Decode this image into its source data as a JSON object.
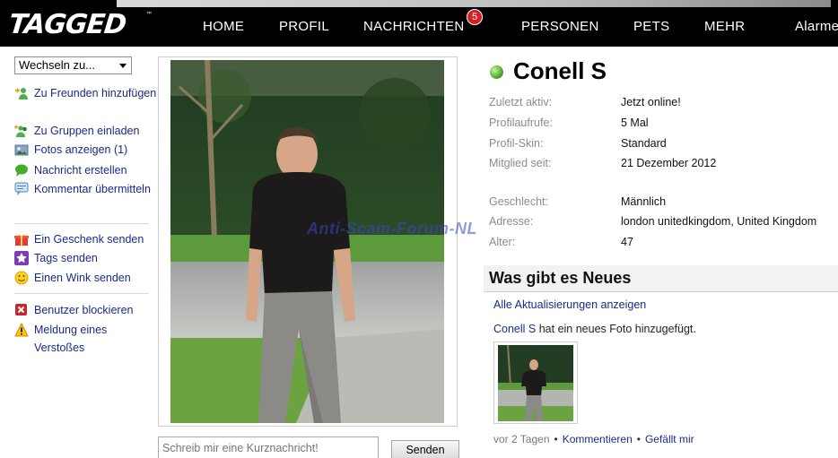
{
  "header": {
    "logo": "TAGGED",
    "logo_tm": "™",
    "nav": [
      "HOME",
      "PROFIL",
      "NACHRICHTEN",
      "PERSONEN",
      "PETS",
      "MEHR",
      "Alarme"
    ],
    "messages_badge": "5"
  },
  "sidebar": {
    "switch_select": "Wechseln zu...",
    "actions": [
      {
        "label": "Zu Freunden hinzufügen",
        "icon": "add-friend-icon"
      },
      {
        "label": "Zu Gruppen einladen",
        "icon": "invite-group-icon"
      },
      {
        "label": "Fotos anzeigen (1)",
        "icon": "photos-icon"
      },
      {
        "label": "Nachricht erstellen",
        "icon": "chat-bubble-icon"
      },
      {
        "label": "Kommentar übermitteln",
        "icon": "comment-icon"
      },
      {
        "label": "Ein Geschenk senden",
        "icon": "gift-icon"
      },
      {
        "label": "Tags senden",
        "icon": "star-icon"
      },
      {
        "label": "Einen Wink senden",
        "icon": "smiley-icon"
      },
      {
        "label": "Benutzer blockieren",
        "icon": "block-icon"
      },
      {
        "label": "Meldung eines Verstoßes",
        "icon": "warning-icon"
      }
    ]
  },
  "shoutbox": {
    "placeholder": "Schreib mir eine Kurznachricht!",
    "send_label": "Senden"
  },
  "profile": {
    "name": "Conell S",
    "details": [
      {
        "label": "Zuletzt aktiv:",
        "value": "Jetzt online!"
      },
      {
        "label": "Profilaufrufe:",
        "value": "5 Mal"
      },
      {
        "label": "Profil-Skin:",
        "value": "Standard"
      },
      {
        "label": "Mitglied seit:",
        "value": "21 Dezember 2012"
      },
      {
        "label": "Geschlecht:",
        "value": "Männlich"
      },
      {
        "label": "Adresse:",
        "value": "london unitedkingdom, United Kingdom"
      },
      {
        "label": "Alter:",
        "value": "47"
      }
    ]
  },
  "watermark": "Anti-Scam-Forum-NL",
  "news": {
    "title": "Was gibt es Neues",
    "all_updates": "Alle Aktualisierungen anzeigen",
    "feed_user": "Conell S",
    "feed_text": " hat ein neues Foto hinzugefügt.",
    "time": "vor 2 Tagen",
    "comment": "Kommentieren",
    "like": "Gefällt mir",
    "separator": "•"
  },
  "colors": {
    "topbar": "#000000",
    "link": "#1a2a8a",
    "label_grey": "#8c8c8c",
    "online_green": "#4fa82a",
    "badge_red": "#d31f26"
  }
}
